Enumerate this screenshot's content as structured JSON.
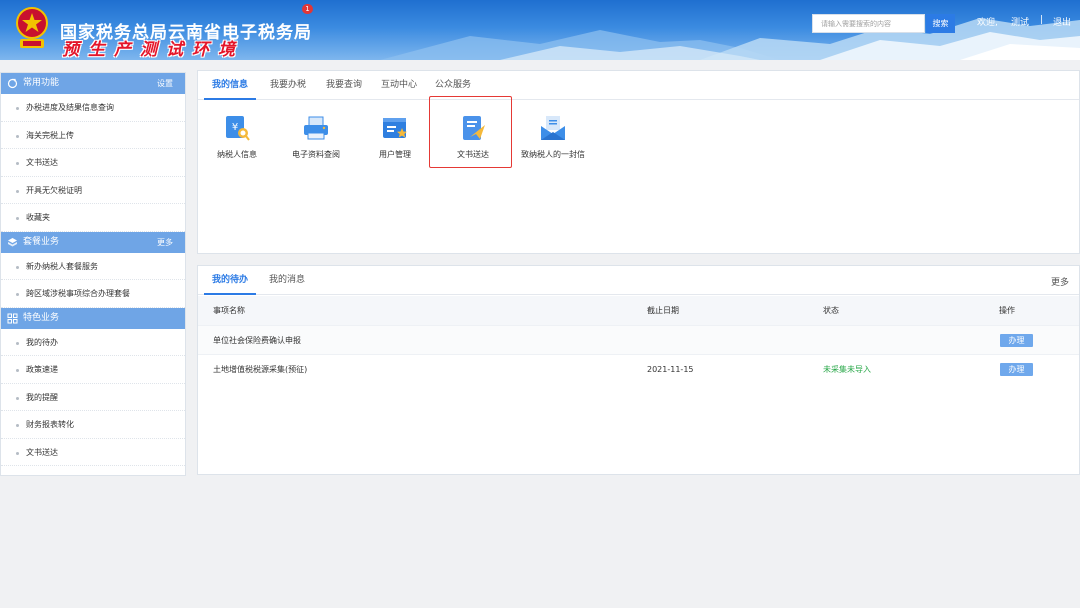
{
  "header": {
    "org_title": "国家税务总局云南省电子税务局",
    "env_title": "预生产测试环境",
    "search_placeholder": "请输入需要搜索的内容",
    "search_button": "搜索",
    "welcome": "欢迎,",
    "username": "测试",
    "separator": "|",
    "logout": "退出"
  },
  "sidebar": {
    "sections": [
      {
        "title": "常用功能",
        "action": "设置",
        "icon": "refresh-icon",
        "items": [
          "办税进度及结果信息查询",
          "海关完税上传",
          "文书送达",
          "开具无欠税证明",
          "收藏夹"
        ]
      },
      {
        "title": "套餐业务",
        "action": "更多",
        "icon": "box-icon",
        "items": [
          "新办纳税人套餐服务",
          "跨区域涉税事项综合办理套餐"
        ]
      },
      {
        "title": "特色业务",
        "action": "",
        "icon": "grid-icon",
        "items": [
          "我的待办",
          "政策速递",
          "我的提醒",
          "财务报表转化",
          "文书送达"
        ]
      }
    ]
  },
  "info_panel": {
    "tabs": [
      "我的信息",
      "我要办税",
      "我要查询",
      "互动中心",
      "公众服务"
    ],
    "functions": [
      {
        "label": "纳税人信息",
        "icon": "taxpayer-info-icon"
      },
      {
        "label": "电子资料查阅",
        "icon": "electronic-document-icon"
      },
      {
        "label": "用户管理",
        "icon": "user-management-icon"
      },
      {
        "label": "文书送达",
        "icon": "document-delivery-icon"
      },
      {
        "label": "致纳税人的一封信",
        "icon": "letter-icon"
      }
    ],
    "highlight_color": "#e53935"
  },
  "todo_panel": {
    "tabs": [
      "我的待办",
      "我的消息"
    ],
    "message_badge": "1",
    "more": "更多",
    "columns": [
      "事项名称",
      "截止日期",
      "状态",
      "操作"
    ],
    "rows": [
      {
        "name": "单位社会保险费确认申报",
        "deadline": "",
        "status": "",
        "action": "办理"
      },
      {
        "name": "土地增值税税源采集(预征)",
        "deadline": "2021-11-15",
        "status": "未采集未导入",
        "action": "办理"
      }
    ]
  },
  "colors": {
    "accent": "#2c7be5",
    "sidebar_header": "#6fa5e6",
    "status_green": "#2aa84a",
    "badge_red": "#e23636"
  }
}
